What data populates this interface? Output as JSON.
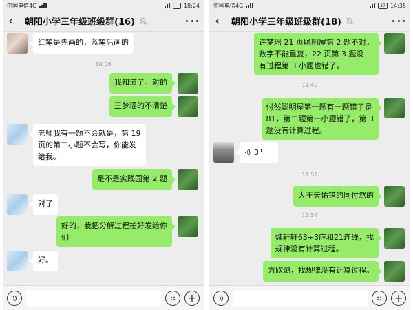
{
  "left": {
    "status": {
      "carrier": "中国电信4G",
      "time": "18:24"
    },
    "title": "朝阳小学三年级班级群(16)",
    "messages": [
      {
        "dir": "in",
        "avatar": "girl",
        "text": "红笔是先画的，蓝笔后画的"
      },
      {
        "type": "time",
        "text": "18:06"
      },
      {
        "dir": "out",
        "text": "我知道了。对的"
      },
      {
        "dir": "out",
        "text": "王梦瑶的不清楚"
      },
      {
        "dir": "in",
        "avatar": "blue",
        "text": "老师我有一题不会就是，第 19\n页的第二小题不会写，你能发\n给我。"
      },
      {
        "dir": "out",
        "text": "是不是实践园第 2 题"
      },
      {
        "dir": "in",
        "avatar": "blue",
        "text": "对了"
      },
      {
        "dir": "out",
        "text": "好的，我把分解过程拍好发给你\n们"
      },
      {
        "dir": "in",
        "avatar": "blue",
        "text": "好。"
      }
    ]
  },
  "right": {
    "status": {
      "carrier": "中国电信4G",
      "battery": "37",
      "time": "14:35"
    },
    "title": "朝阳小学三年级班级群(18)",
    "messages": [
      {
        "dir": "out",
        "text": "许梦瑶 21 页聪明屋第 2 题不对，\n数字不能重复，22 页第 3 题没\n有过程第 3 小题也错了。"
      },
      {
        "type": "time",
        "text": "11:49"
      },
      {
        "dir": "out",
        "text": "付然聪明屋第一题有一题错了是\n81，第二题第一小题错了，第 3\n题没有计算过程。"
      },
      {
        "dir": "in",
        "avatar": "photo",
        "type": "voice",
        "text": "3\""
      },
      {
        "type": "time",
        "text": "11:51"
      },
      {
        "dir": "out",
        "text": "大王天佑错的同付然的"
      },
      {
        "type": "time",
        "text": "11:54"
      },
      {
        "dir": "out",
        "text": "魏轩轩63÷3应和21连线，找\n规律没有计算过程。"
      },
      {
        "dir": "out",
        "text": "方欣璐，找规律没有计算过程。"
      }
    ]
  },
  "icons": {
    "back": "back-arrow-icon",
    "mute": "mute-bell-icon",
    "more": "more-icon",
    "voice_input": "voice-input-icon",
    "emoji": "emoji-icon",
    "plus": "plus-icon"
  }
}
